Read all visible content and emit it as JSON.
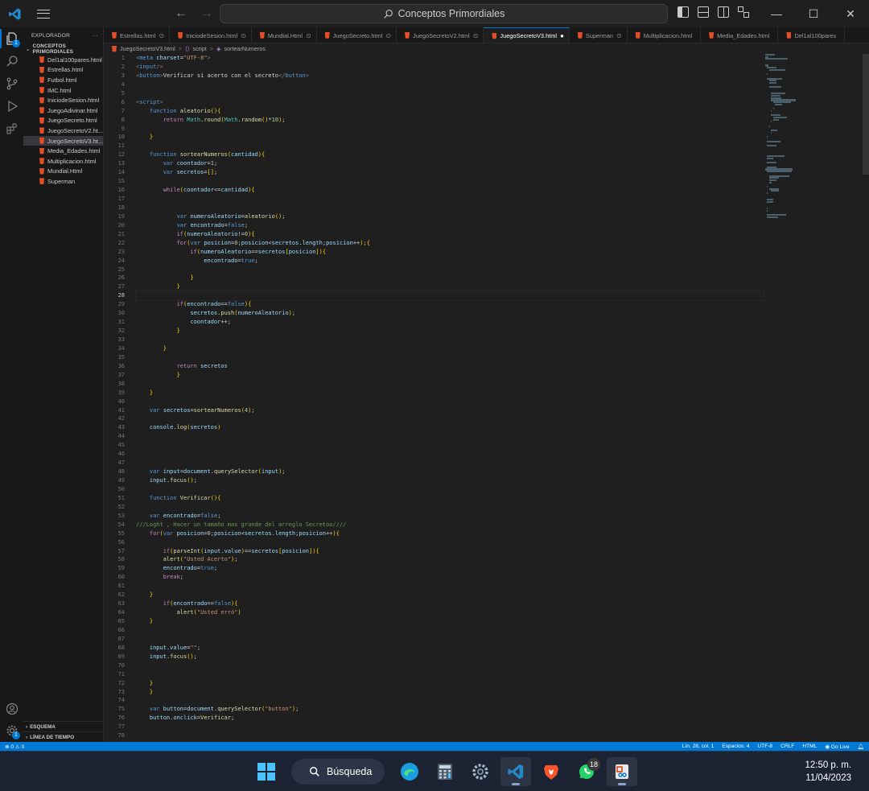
{
  "window": {
    "command_center_text": "Conceptos Primordiales"
  },
  "sidebar": {
    "header": "EXPLORADOR",
    "more": "···",
    "folder": "CONCEPTOS PRIMORDIALES",
    "files": [
      {
        "label": "Del1al100pares.html"
      },
      {
        "label": "Estrellas.html"
      },
      {
        "label": "Futbol.html"
      },
      {
        "label": "IMC.html"
      },
      {
        "label": "IniciodeSesion.html"
      },
      {
        "label": "JuegoAdivinar.html"
      },
      {
        "label": "JuegoSecreto.html"
      },
      {
        "label": "JuegoSecretoV2.ht..."
      },
      {
        "label": "JuegoSecretoV3.ht...",
        "selected": true
      },
      {
        "label": "Media_Edades.html"
      },
      {
        "label": "Multiplicacion.html"
      },
      {
        "label": "Mundial.Html"
      },
      {
        "label": "Superman"
      }
    ],
    "outline": "ESQUEMA",
    "timeline": "LÍNEA DE TIEMPO"
  },
  "tabs": [
    {
      "label": "Estrellas.html",
      "close": "⊙"
    },
    {
      "label": "IniciodeSesion.html",
      "close": "⊙"
    },
    {
      "label": "Mundial.Html",
      "close": "⊙"
    },
    {
      "label": "JuegoSecreto.html",
      "close": "⊙"
    },
    {
      "label": "JuegoSecretoV2.html",
      "close": "⊙"
    },
    {
      "label": "JuegoSecretoV3.html",
      "close": "●",
      "active": true
    },
    {
      "label": "Superman",
      "close": "⊙"
    },
    {
      "label": "Multiplicacion.html",
      "close": ""
    },
    {
      "label": "Media_Edades.html",
      "close": ""
    },
    {
      "label": "Del1al100pares",
      "close": ""
    }
  ],
  "breadcrumb": {
    "file": "JuegoSecretoV3.html",
    "sep": ">",
    "item1": "script",
    "item2": "sortearNumeros"
  },
  "editor": {
    "current_line": 28,
    "lines": [
      "<meta charset=\"UTF-8\">",
      "<input/>",
      "<button>Verificar si acerto con el secreto</button>",
      "",
      "",
      "<script>",
      "    function aleatorio(){",
      "        return Math.round(Math.random()*10);",
      "",
      "    }",
      "",
      "    function sortearNumeros(cantidad){",
      "        var coontador=1;",
      "        var secretos=[];",
      "",
      "        while(coontador<=cantidad){",
      "",
      "",
      "            var numeroAleatorio=aleatorio();",
      "            var encontrado=false;",
      "            if(numeroAleatorio!=0){",
      "            for(var posicion=0;posicion<secretos.length;posicion++);{",
      "                if(numeroAleatorio==secretos[posicion]){",
      "                    encontrado=true;",
      "",
      "                }",
      "            }",
      "",
      "            if(encontrado==false){",
      "                secretos.push(numeroAleatorio);",
      "                coontador++;",
      "            }",
      "",
      "        }",
      "",
      "            return secretos",
      "            }",
      "",
      "    }",
      "",
      "    var secretos=sortearNumeros(4);",
      "",
      "    console.log(secretos)",
      "",
      "",
      "",
      "",
      "    var input=document.querySelector(input);",
      "    input.focus();",
      "",
      "    function Verificar(){",
      "",
      "    var encontrado=false;",
      "///Loght , Hacer un tamaño mas grande del arreglo Secretoo////",
      "    for(var posicion=0;posicion<secretos.length;posicion++){",
      "",
      "        if(parseInt(input.value)==secretos[posicion]){",
      "        alert(\"Usted Acerto\");",
      "        encontrado=true;",
      "        break;",
      "",
      "    }",
      "        if(encontrado==false){",
      "            alert(\"Usted erró\")",
      "    }",
      "",
      "",
      "    input.value=\"\";",
      "    input.focus();",
      "",
      "",
      "    }",
      "    }",
      "",
      "    var button=document.querySelector(\"button\");",
      "    button.onclick=Verificar;",
      "",
      ""
    ]
  },
  "status": {
    "errors": "⊗ 0 ⚠ 0",
    "position": "Lín. 28, col. 1",
    "spaces": "Espacios: 4",
    "encoding": "UTF-8",
    "eol": "CRLF",
    "language": "HTML",
    "golive": "Go Live"
  },
  "taskbar": {
    "search_label": "Búsqueda",
    "whatsapp_badge": "18",
    "time": "12:50 p. m.",
    "date": "11/04/2023"
  },
  "colors": {
    "accent": "#0078d4",
    "editor_bg": "#1f1f1f",
    "sidebar_bg": "#181818",
    "taskbar_bg": "#1c2333"
  }
}
